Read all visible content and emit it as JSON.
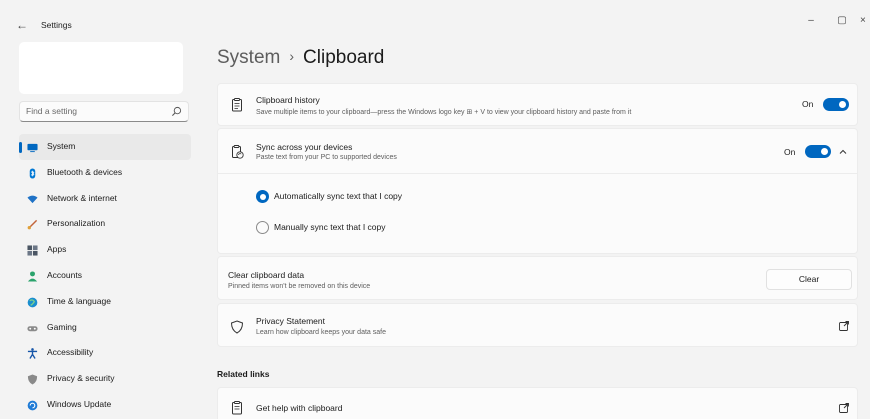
{
  "window": {
    "title": "Settings",
    "back_glyph": "←",
    "minimize_glyph": "–",
    "maximize_glyph": "▢",
    "close_glyph": "×"
  },
  "search": {
    "placeholder": "Find a setting"
  },
  "nav": {
    "items": [
      {
        "label": "System",
        "icon": "monitor-icon",
        "color": "#0067c0",
        "selected": true
      },
      {
        "label": "Bluetooth & devices",
        "icon": "bluetooth-icon",
        "color": "#0078d4"
      },
      {
        "label": "Network & internet",
        "icon": "wifi-icon",
        "color": "#1f72c6"
      },
      {
        "label": "Personalization",
        "icon": "brush-icon",
        "color": "#c2643a"
      },
      {
        "label": "Apps",
        "icon": "apps-icon",
        "color": "#4a5563"
      },
      {
        "label": "Accounts",
        "icon": "person-icon",
        "color": "#2ba36c"
      },
      {
        "label": "Time & language",
        "icon": "globe-icon",
        "color": "#1a8ecf"
      },
      {
        "label": "Gaming",
        "icon": "gamepad-icon",
        "color": "#7a7a7a"
      },
      {
        "label": "Accessibility",
        "icon": "accessibility-icon",
        "color": "#1756a9"
      },
      {
        "label": "Privacy & security",
        "icon": "shield-icon",
        "color": "#7a7a7a"
      },
      {
        "label": "Windows Update",
        "icon": "update-icon",
        "color": "#1f7bd6"
      }
    ]
  },
  "breadcrumb": {
    "parent": "System",
    "separator": "›",
    "current": "Clipboard"
  },
  "clipboard_history": {
    "title": "Clipboard history",
    "desc": "Save multiple items to your clipboard—press the Windows logo key ⊞ + V to view your clipboard history and paste from it",
    "state_label": "On",
    "on": true
  },
  "sync": {
    "title": "Sync across your devices",
    "desc": "Paste text from your PC to supported devices",
    "state_label": "On",
    "on": true,
    "expanded": true,
    "options": [
      {
        "label": "Automatically sync text that I copy",
        "selected": true
      },
      {
        "label": "Manually sync text that I copy",
        "selected": false
      }
    ]
  },
  "clear_data": {
    "title": "Clear clipboard data",
    "desc": "Pinned items won't be removed on this device",
    "button_label": "Clear"
  },
  "privacy": {
    "title": "Privacy Statement",
    "desc": "Learn how clipboard keeps your data safe"
  },
  "related": {
    "heading": "Related links",
    "items": [
      {
        "label": "Get help with clipboard"
      }
    ]
  },
  "colors": {
    "accent": "#0067c0",
    "background": "#f3f3f3",
    "card": "#fbfbfb"
  }
}
